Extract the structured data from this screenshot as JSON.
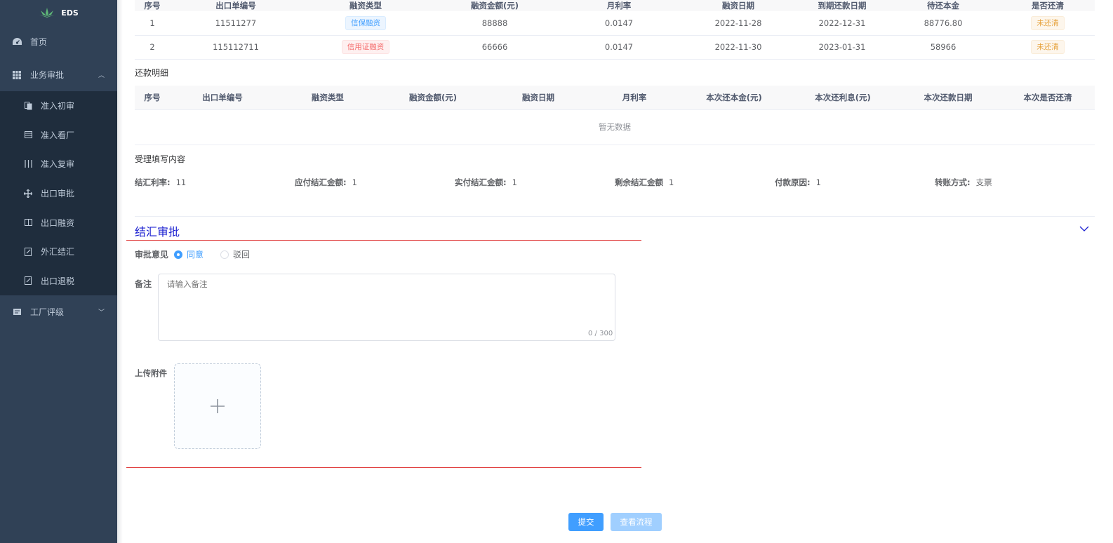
{
  "app": {
    "logo_text": "EDS"
  },
  "sidebar": {
    "items": [
      {
        "label": "首页",
        "icon": "dashboard-icon"
      },
      {
        "label": "业务审批",
        "icon": "grid-icon",
        "expanded": true,
        "children": [
          {
            "label": "准入初审",
            "icon": "copy-icon"
          },
          {
            "label": "准入看厂",
            "icon": "window-icon"
          },
          {
            "label": "准入复审",
            "icon": "columns-icon"
          },
          {
            "label": "出口审批",
            "icon": "move-icon"
          },
          {
            "label": "出口融资",
            "icon": "book-icon"
          },
          {
            "label": "外汇结汇",
            "icon": "edit-icon"
          },
          {
            "label": "出口退税",
            "icon": "edit-icon"
          }
        ]
      },
      {
        "label": "工厂评级",
        "icon": "card-icon",
        "expanded": false
      }
    ]
  },
  "finance_table": {
    "columns": [
      "序号",
      "出口单编号",
      "融资类型",
      "融资金额(元)",
      "月利率",
      "融资日期",
      "到期还款日期",
      "待还本金",
      "是否还清"
    ],
    "rows": [
      {
        "no": "1",
        "order": "11511277",
        "type": "信保融资",
        "type_style": "blue",
        "amount": "88888",
        "rate": "0.0147",
        "date": "2022-11-28",
        "due": "2022-12-31",
        "principal": "88776.80",
        "status": "未还清"
      },
      {
        "no": "2",
        "order": "115112711",
        "type": "信用证融资",
        "type_style": "red",
        "amount": "66666",
        "rate": "0.0147",
        "date": "2022-11-30",
        "due": "2023-01-31",
        "principal": "58966",
        "status": "未还清"
      }
    ]
  },
  "repayment": {
    "title": "还款明细",
    "columns": [
      "序号",
      "出口单编号",
      "融资类型",
      "融资金额(元)",
      "融资日期",
      "月利率",
      "本次还本金(元)",
      "本次还利息(元)",
      "本次还款日期",
      "本次是否还清"
    ],
    "empty_text": "暂无数据"
  },
  "info": {
    "title": "受理填写内容",
    "fields": [
      {
        "label": "结汇利率:",
        "value": "11"
      },
      {
        "label": "应付结汇金额:",
        "value": "1"
      },
      {
        "label": "实付结汇金额:",
        "value": "1"
      },
      {
        "label": "剩余结汇金额",
        "value": "1"
      },
      {
        "label": "付款原因:",
        "value": "1"
      },
      {
        "label": "转账方式:",
        "value": "支票"
      }
    ]
  },
  "approval": {
    "title": "结汇审批",
    "opinion_label": "审批意见",
    "options": [
      "同意",
      "驳回"
    ],
    "selected": "同意",
    "remark_label": "备注",
    "remark_placeholder": "请输入备注",
    "remark_count": "0 / 300",
    "upload_label": "上传附件"
  },
  "actions": {
    "submit": "提交",
    "view_flow": "查看流程"
  },
  "colors": {
    "sidebar_bg": "#304156",
    "primary": "#409eff",
    "section_title": "#1a1fd0",
    "red_line": "#e03c3c"
  }
}
